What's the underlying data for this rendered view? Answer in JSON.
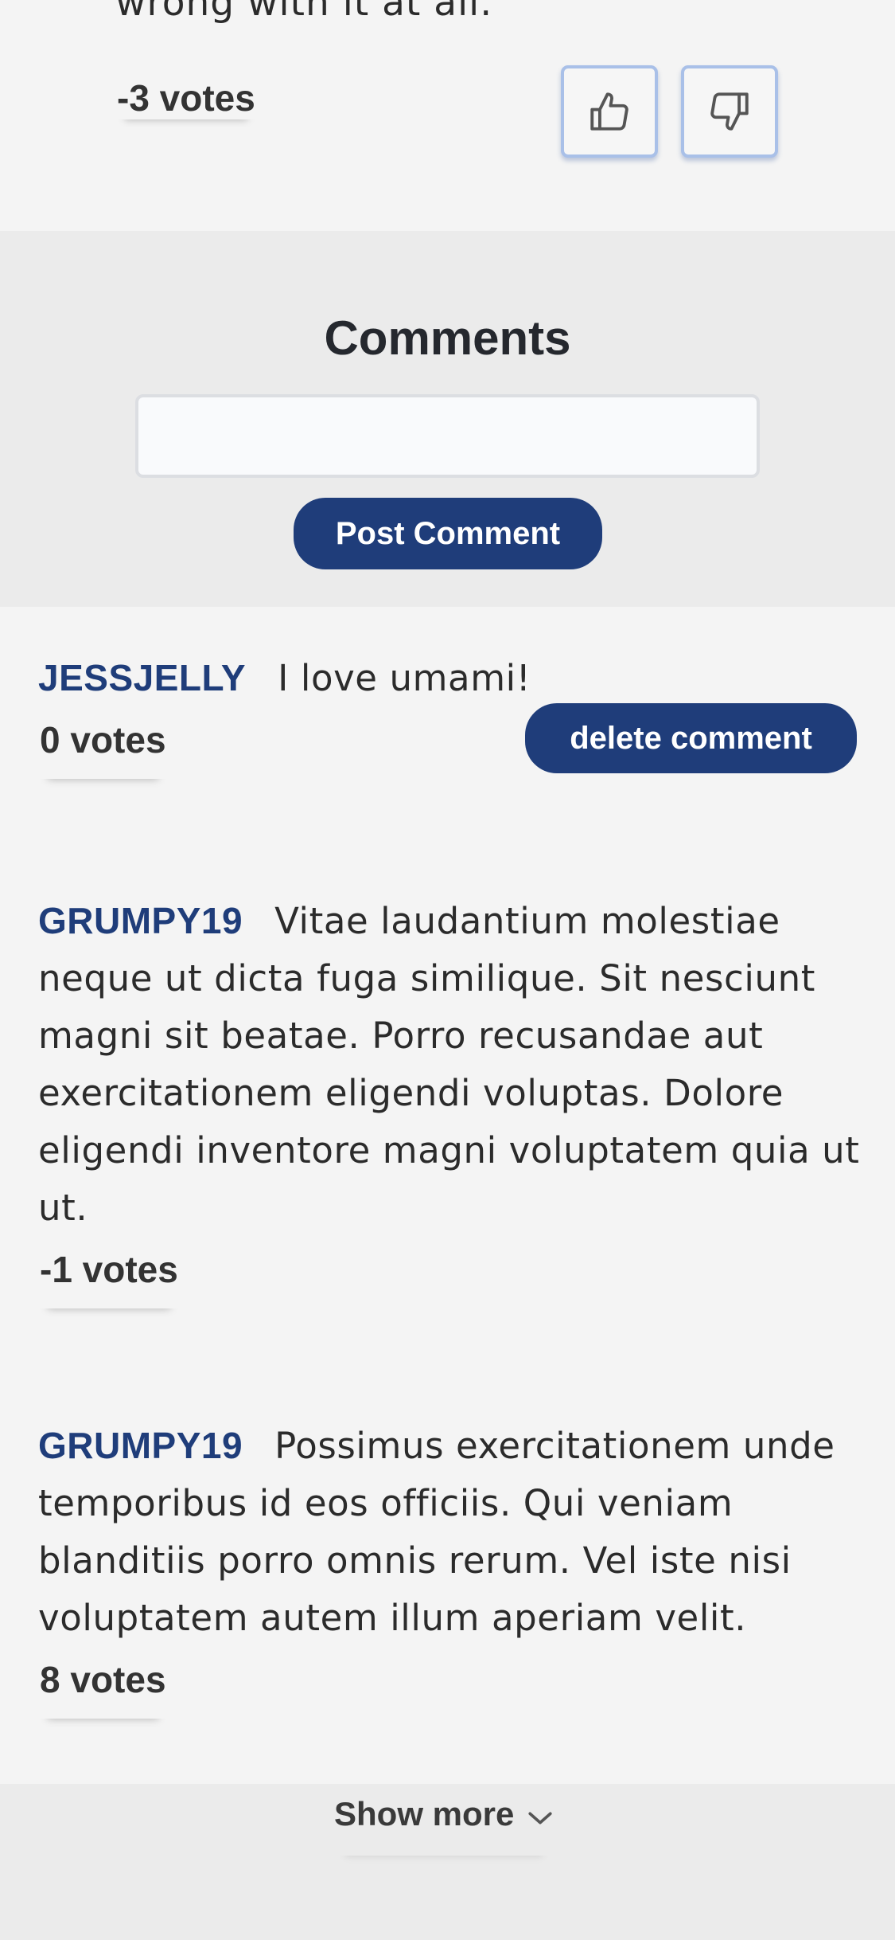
{
  "article": {
    "body_tail": "wrong with it at all.",
    "votes_label": "-3 votes"
  },
  "comments_section": {
    "title": "Comments",
    "input_value": "",
    "input_placeholder": "",
    "post_button_label": "Post Comment"
  },
  "comments": [
    {
      "author": "JESSJELLY",
      "body": "I love umami!",
      "votes_label": "0 votes",
      "delete_label": "delete comment"
    },
    {
      "author": "GRUMPY19",
      "body": "Vitae laudantium molestiae neque ut dicta fuga similique. Sit nesciunt magni sit beatae. Porro recusandae aut exercitationem eligendi voluptas. Dolore eligendi inventore magni voluptatem quia ut ut.",
      "votes_label": "-1 votes"
    },
    {
      "author": "GRUMPY19",
      "body": "Possimus exercitationem unde temporibus id eos officiis. Qui veniam blanditiis porro omnis rerum. Vel iste nisi voluptatem autem illum aperiam velit.",
      "votes_label": "8 votes"
    }
  ],
  "show_more": {
    "label": "Show more",
    "icon": "chevron-down-icon"
  },
  "icons": {
    "upvote": "thumbs-up-icon",
    "downvote": "thumbs-down-icon"
  },
  "colors": {
    "brand_navy": "#1f3d7a",
    "vote_button_border": "#a9c0e8",
    "page_background": "#f4f4f4",
    "panel_background": "#ebebeb"
  }
}
